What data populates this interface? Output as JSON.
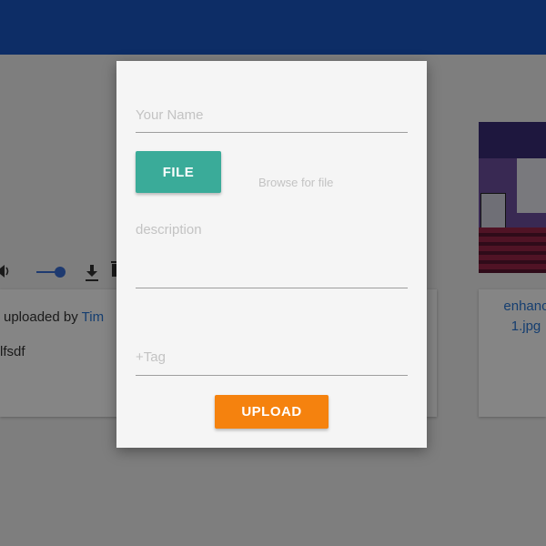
{
  "background": {
    "post": {
      "uploaded_by_prefix": "uploaded by",
      "uploader": "Tim",
      "description": "lfsdf"
    },
    "thumbnail": {
      "caption_line1": "enhanc",
      "caption_line2": "1.jpg"
    },
    "player": {
      "volume_icon": "volume-icon",
      "download_icon": "download-icon",
      "delete_icon": "trash-icon"
    }
  },
  "upload_dialog": {
    "name_placeholder": "Your Name",
    "file_button_label": "FILE",
    "browse_text": "Browse for file",
    "description_placeholder": "description",
    "tag_placeholder": "+Tag",
    "upload_button_label": "UPLOAD"
  },
  "colors": {
    "topbar": "#1a56c4",
    "file_button": "#3aab99",
    "upload_button": "#f5820e",
    "link": "#2a77d6"
  }
}
